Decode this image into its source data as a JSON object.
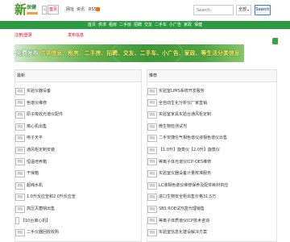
{
  "logo": {
    "main": "新",
    "sub": "保健"
  },
  "nav": {
    "home_icon": "home-icon",
    "items": [
      {
        "label": "首页",
        "active": true
      },
      {
        "label": "网址",
        "active": false
      },
      {
        "label": "资讯",
        "active": false
      },
      {
        "label": "RSS",
        "active": false,
        "icon": "rss-icon"
      }
    ]
  },
  "search": {
    "placeholder": "Search",
    "scope": "全部",
    "button": "Search"
  },
  "category_bar": [
    "首页",
    "供求",
    "租房",
    "二手房",
    "招聘",
    "交友",
    "二手车",
    "小广告",
    "家政",
    "保健"
  ],
  "notice": {
    "left": "注册|登录",
    "right": "发布信息"
  },
  "banner": {
    "lead": "免费发布",
    "text": "供求信息、租房、二手房、招聘、交友、二手车、小广告、家政、等生活分类信息"
  },
  "panels": {
    "latest": {
      "title": "最新",
      "rows": [
        {
          "tag": "供应",
          "title": "实验仪器设备"
        },
        {
          "tag": "供应",
          "title": "色谱仪维修"
        },
        {
          "tag": "供应",
          "title": "原子吸收光谱仪配件"
        },
        {
          "tag": "供应",
          "title": "离心机出售"
        },
        {
          "tag": "供应",
          "title": "电子天平"
        },
        {
          "tag": "供应",
          "title": "通风柜定制安装"
        },
        {
          "tag": "供应",
          "title": "恒温培养箱"
        },
        {
          "tag": "供应",
          "title": "干燥箱"
        },
        {
          "tag": "供应",
          "title": "超纯水机"
        },
        {
          "tag": "供应",
          "title": "1.0升反应釜和2.0升反应釜"
        },
        {
          "tag": "供应",
          "title": "高压灭菌锅出售"
        },
        {
          "tag": "",
          "title": "【10台离心机】"
        },
        {
          "tag": "供应",
          "title": "二手仪器回收收购"
        }
      ]
    },
    "recommended": {
      "title": "推荐",
      "rows": [
        {
          "tag": "供应",
          "title": "实验室LIMS系统开发服务"
        },
        {
          "tag": "供应",
          "title": "全自动生化分析仪厂家直销"
        },
        {
          "tag": "供应",
          "title": "实验室家具实验台通风柜定制"
        },
        {
          "tag": "供应",
          "title": "微生物检测试剂"
        },
        {
          "tag": "供应",
          "title": "二手安捷伦气相色谱仪液相色谱仪出售"
        },
        {
          "tag": "供应",
          "title": "【1.0升】旋蒸仪【2.0升】旋蒸仪"
        },
        {
          "tag": "供应",
          "title": "等离子体光谱仪ICP-OES维修"
        },
        {
          "tag": "供应",
          "title": "实验室仪器设备计量校准服务"
        },
        {
          "tag": "供应",
          "title": "LC液相色谱仪维修保养及配件耗材供应"
        },
        {
          "tag": "供应",
          "title": "进口生物安全柜出售价格31.5万"
        },
        {
          "tag": "供应",
          "title": "SBS ROE试剂盒代理销售"
        },
        {
          "tag": "供应",
          "title": "等离子体质谱仪ICP技术咨询"
        },
        {
          "tag": "供应",
          "title": "实验室信息化建设解决方案"
        }
      ]
    }
  },
  "colors": {
    "brand_green": "#2f9a44",
    "notice_red": "#e60012",
    "rss_orange": "#ff6a00",
    "button_border": "#3b7fc4"
  }
}
